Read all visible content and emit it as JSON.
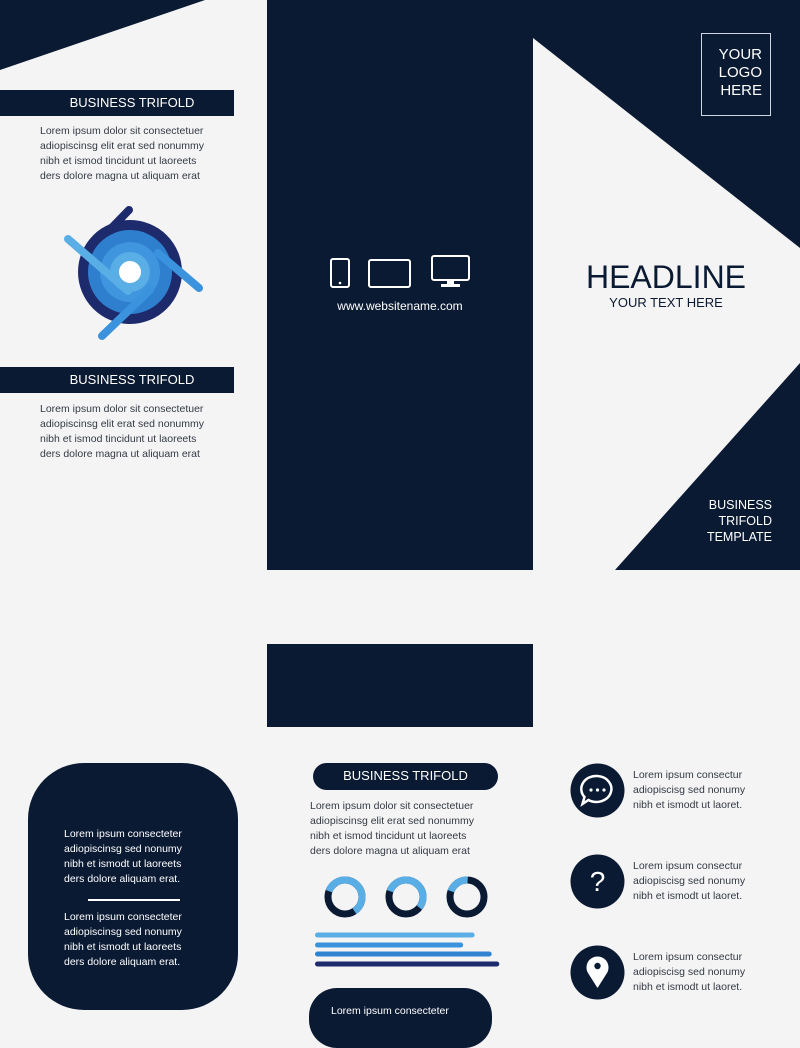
{
  "colors": {
    "navy": "#0b1a33",
    "background": "#f4f4f4",
    "light_blue": "#5aaee6",
    "mid_blue": "#3388d6",
    "dark_blue": "#1d2a6b"
  },
  "left_panel": {
    "banner1": "BUSINESS TRIFOLD",
    "text1": "Lorem ipsum dolor sit consectetuer\nadiopiscinsg elit erat sed nonummy\nnibh et ismod tincidunt ut laoreets\nders dolore magna ut aliquam erat",
    "banner2": "BUSINESS TRIFOLD",
    "text2": "Lorem ipsum dolor sit consectetuer\nadiopiscinsg elit erat sed nonummy\nnibh et ismod tincidunt ut laoreets\nders dolore magna ut aliquam erat",
    "logo_icon": "blue-swirl-logo"
  },
  "center_panel": {
    "icons": [
      "phone-icon",
      "tablet-icon",
      "monitor-icon"
    ],
    "website": "www.websitename.com"
  },
  "right_panel": {
    "logo_placeholder": "YOUR\nLOGO\nHERE",
    "headline": "HEADLINE",
    "subheadline": "YOUR TEXT HERE",
    "footer": "BUSINESS\nTRIFOLD\nTEMPLATE"
  },
  "inside_left": {
    "text1": "Lorem ipsum consecteter\nadiopiscinsg sed nonumy\nnibh et ismodt ut laoreets\nders dolore  aliquam erat.",
    "text2": "Lorem ipsum consecteter\nadiopiscinsg sed nonumy\nnibh et ismodt ut laoreets\nders dolore  aliquam erat."
  },
  "inside_center": {
    "pill": "BUSINESS TRIFOLD",
    "text": "Lorem ipsum dolor sit consectetuer\nadiopiscinsg elit erat sed nonummy\nnibh et ismod tincidunt ut laoreets\nders dolore magna ut aliquam erat",
    "donuts": [
      0.6,
      0.55,
      0.2
    ],
    "bars": [
      {
        "value": 0.84,
        "color": "#5aaee6"
      },
      {
        "value": 0.78,
        "color": "#3a93dc"
      },
      {
        "value": 0.93,
        "color": "#2f84d2"
      },
      {
        "value": 0.97,
        "color": "#1d2a6b"
      }
    ],
    "bottom_card_text": "Lorem ipsum consecteter"
  },
  "inside_right": {
    "items": [
      {
        "icon": "chat-bubble-icon",
        "text": "Lorem ipsum consectur\nadiopiscisg sed nonumy\nnibh et ismodt ut laoret."
      },
      {
        "icon": "question-mark-icon",
        "text": "Lorem ipsum consectur\nadiopiscisg sed nonumy\nnibh et ismodt ut laoret."
      },
      {
        "icon": "location-pin-icon",
        "text": "Lorem ipsum consectur\nadiopiscisg sed nonumy\nnibh et ismodt ut laoret."
      }
    ]
  }
}
